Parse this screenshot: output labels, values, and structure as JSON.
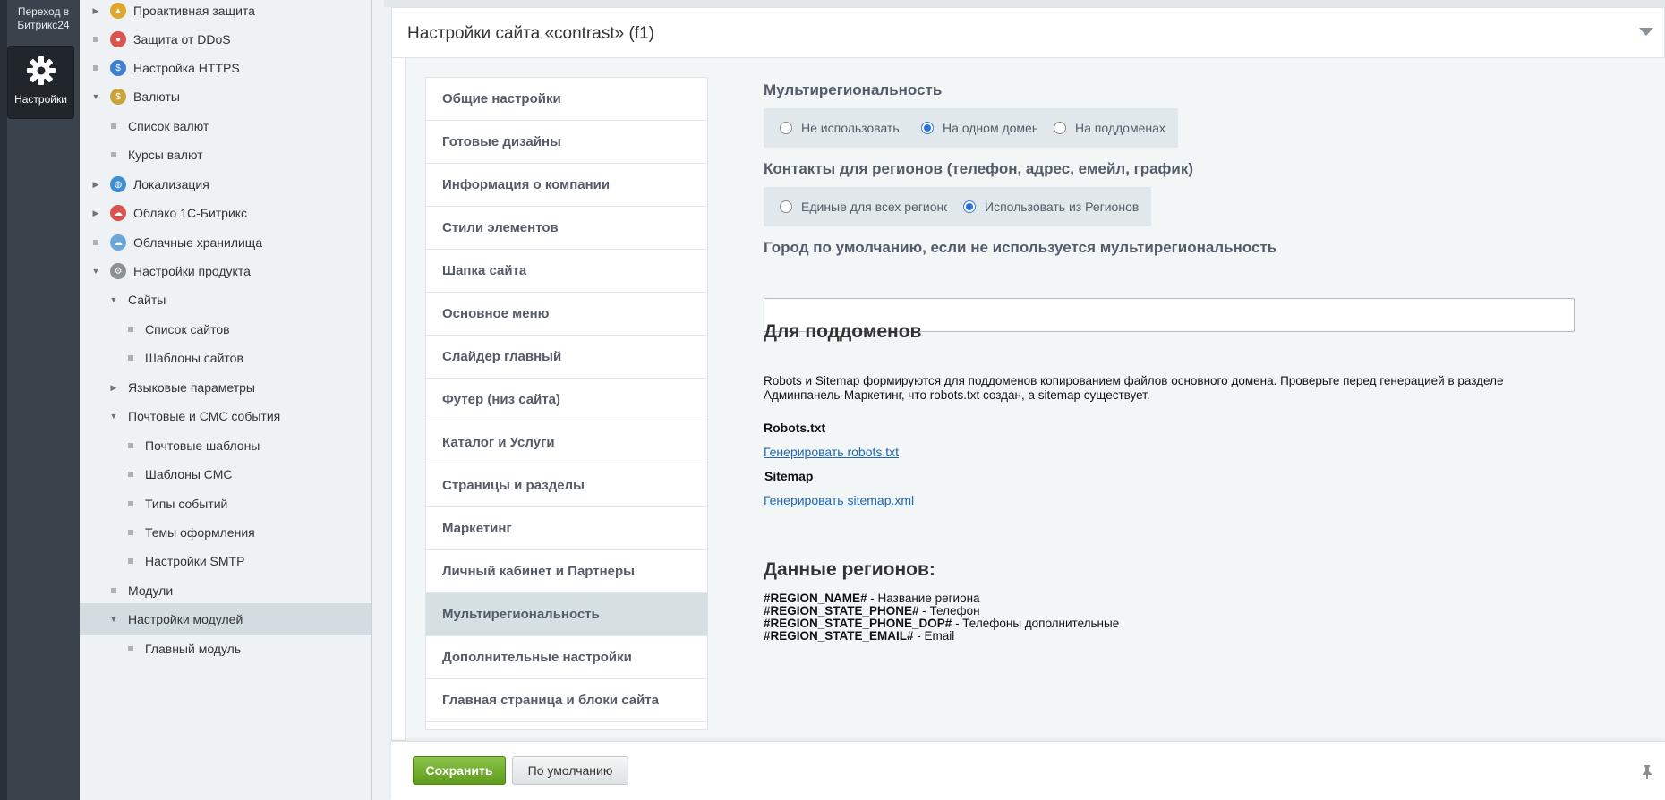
{
  "leftbar": {
    "goto_label": "Переход в Битрикс24",
    "settings_label": "Настройки"
  },
  "tree": {
    "items": [
      {
        "label": "Проактивная защита",
        "marker": "arrow-right",
        "icon": "lock-icon",
        "level": 0
      },
      {
        "label": "Защита от DDoS",
        "marker": "bullet",
        "icon": "shield-icon",
        "level": 0
      },
      {
        "label": "Настройка HTTPS",
        "marker": "bullet",
        "icon": "https-icon",
        "level": 0
      },
      {
        "label": "Валюты",
        "marker": "arrow-down",
        "icon": "currency-icon",
        "level": 0
      },
      {
        "label": "Список валют",
        "marker": "bullet",
        "icon": "",
        "level": 1
      },
      {
        "label": "Курсы валют",
        "marker": "bullet",
        "icon": "",
        "level": 1
      },
      {
        "label": "Локализация",
        "marker": "arrow-right",
        "icon": "globe-icon",
        "level": 0
      },
      {
        "label": "Облако 1С-Битрикс",
        "marker": "arrow-right",
        "icon": "cloud-icon",
        "level": 0
      },
      {
        "label": "Облачные хранилища",
        "marker": "bullet",
        "icon": "storage-icon",
        "level": 0
      },
      {
        "label": "Настройки продукта",
        "marker": "arrow-down",
        "icon": "gear-icon",
        "level": 0
      },
      {
        "label": "Сайты",
        "marker": "arrow-down",
        "icon": "",
        "level": 1
      },
      {
        "label": "Список сайтов",
        "marker": "bullet",
        "icon": "",
        "level": 2
      },
      {
        "label": "Шаблоны сайтов",
        "marker": "bullet",
        "icon": "",
        "level": 2
      },
      {
        "label": "Языковые параметры",
        "marker": "arrow-right",
        "icon": "",
        "level": 1
      },
      {
        "label": "Почтовые и СМС события",
        "marker": "arrow-down",
        "icon": "",
        "level": 1
      },
      {
        "label": "Почтовые шаблоны",
        "marker": "bullet",
        "icon": "",
        "level": 2
      },
      {
        "label": "Шаблоны СМС",
        "marker": "bullet",
        "icon": "",
        "level": 2
      },
      {
        "label": "Типы событий",
        "marker": "bullet",
        "icon": "",
        "level": 2
      },
      {
        "label": "Темы оформления",
        "marker": "bullet",
        "icon": "",
        "level": 2
      },
      {
        "label": "Настройки SMTP",
        "marker": "bullet",
        "icon": "",
        "level": 2
      },
      {
        "label": "Модули",
        "marker": "bullet",
        "icon": "",
        "level": 1
      },
      {
        "label": "Настройки модулей",
        "marker": "arrow-down",
        "icon": "",
        "level": 1,
        "selected": true
      },
      {
        "label": "Главный модуль",
        "marker": "bullet",
        "icon": "",
        "level": 2
      }
    ]
  },
  "panel": {
    "title": "Настройки сайта «contrast» (f1)"
  },
  "tabs": [
    {
      "label": "Общие настройки"
    },
    {
      "label": "Готовые дизайны"
    },
    {
      "label": "Информация о компании"
    },
    {
      "label": "Стили элементов"
    },
    {
      "label": "Шапка сайта"
    },
    {
      "label": "Основное меню"
    },
    {
      "label": "Слайдер главный"
    },
    {
      "label": "Футер (низ сайта)"
    },
    {
      "label": "Каталог и Услуги"
    },
    {
      "label": "Страницы и разделы"
    },
    {
      "label": "Маркетинг"
    },
    {
      "label": "Личный кабинет и Партнеры"
    },
    {
      "label": "Мультирегиональность",
      "active": true
    },
    {
      "label": "Дополнительные настройки"
    },
    {
      "label": "Главная страница и блоки сайта"
    }
  ],
  "content": {
    "multiregion": {
      "label": "Мультирегиональность",
      "options": [
        "Не использовать",
        "На одном домене",
        "На поддоменах"
      ],
      "selected": "На одном домене"
    },
    "contacts": {
      "label": "Контакты для регионов (телефон, адрес, емейл, график)",
      "options": [
        "Единые для всех регионов",
        "Использовать из Регионов"
      ],
      "selected": "Использовать из Регионов"
    },
    "city": {
      "label": "Город по умолчанию, если не используется мультирегиональность",
      "value": ""
    },
    "subdomains": {
      "heading": "Для поддоменов",
      "text": "Robots и Sitemap формируются для поддоменов копированием файлов основного домена. Проверьте перед генерацией в разделе Админпанель-Маркетинг, что robots.txt создан, а sitemap существует.",
      "robots_label": "Robots.txt",
      "robots_link": "Генерировать robots.txt",
      "sitemap_label": "Sitemap",
      "sitemap_link": "Генерировать sitemap.xml"
    },
    "regions_data": {
      "heading": "Данные регионов:",
      "vars": [
        {
          "code": "#REGION_NAME#",
          "desc": " - Название региона"
        },
        {
          "code": "#REGION_STATE_PHONE#",
          "desc": " - Телефон"
        },
        {
          "code": "#REGION_STATE_PHONE_DOP#",
          "desc": " - Телефоны дополнительные"
        },
        {
          "code": "#REGION_STATE_EMAIL#",
          "desc": " - Email"
        }
      ]
    }
  },
  "footer": {
    "save_label": "Сохранить",
    "default_label": "По умолчанию"
  },
  "colors": {
    "save_button": "#6aa821",
    "active_tab": "#d6dfe2",
    "link": "#2067b0",
    "leftbar": "#3a424b"
  }
}
